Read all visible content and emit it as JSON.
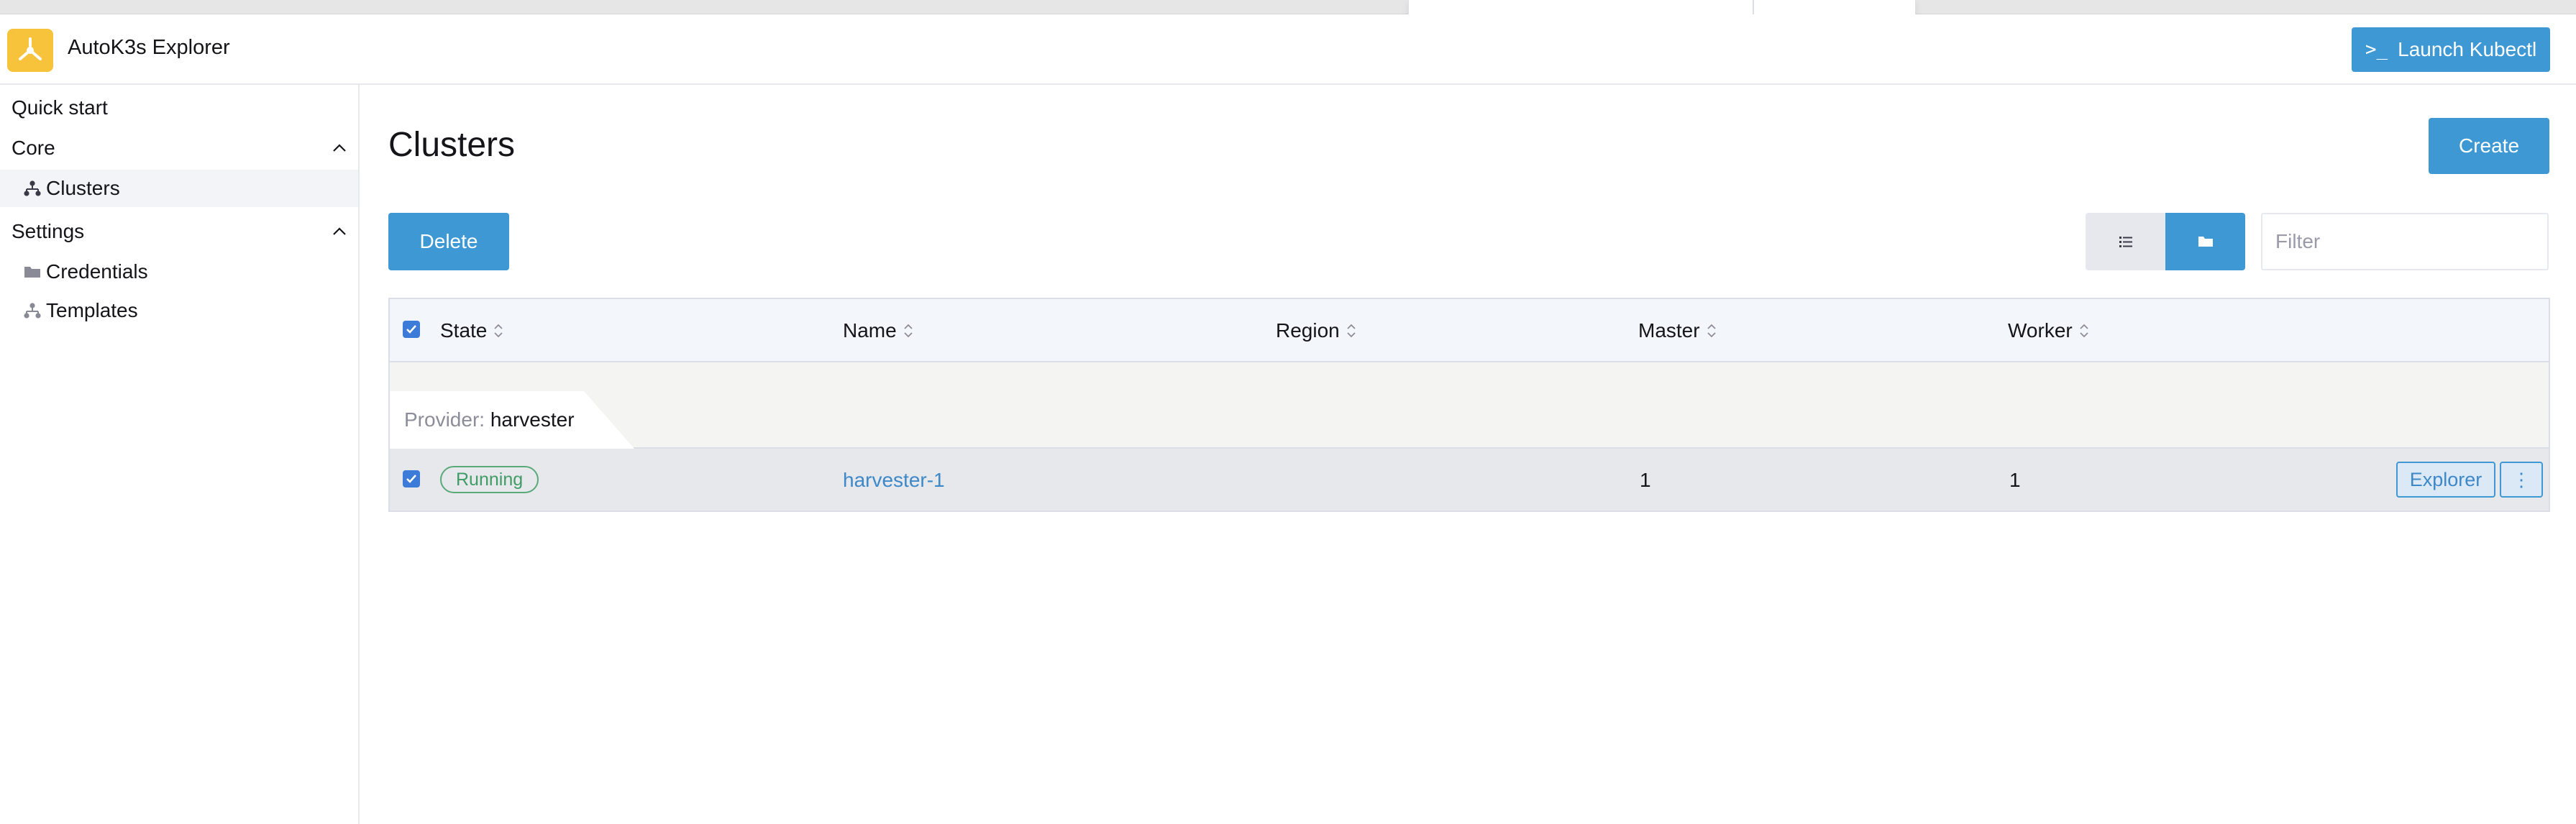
{
  "app": {
    "title": "AutoK3s Explorer",
    "logo_icon": "autok3s-logo-icon",
    "brand_color": "#f7c33a",
    "accent_color": "#3d98d3"
  },
  "header": {
    "launch_kubectl_label": "Launch Kubectl",
    "launch_kubectl_icon": "terminal-icon"
  },
  "sidebar": {
    "quick_start": "Quick start",
    "groups": [
      {
        "label": "Core",
        "items": [
          {
            "label": "Clusters",
            "icon": "cluster-icon",
            "active": true
          }
        ]
      },
      {
        "label": "Settings",
        "items": [
          {
            "label": "Credentials",
            "icon": "folder-icon"
          },
          {
            "label": "Templates",
            "icon": "cluster-icon"
          }
        ]
      }
    ]
  },
  "page": {
    "title": "Clusters",
    "create_label": "Create",
    "delete_label": "Delete",
    "filter_placeholder": "Filter",
    "view_modes": [
      {
        "icon": "list-icon",
        "selected": false
      },
      {
        "icon": "folder-icon",
        "selected": true
      }
    ]
  },
  "table": {
    "columns": [
      "State",
      "Name",
      "Region",
      "Master",
      "Worker"
    ],
    "group": {
      "key": "Provider:",
      "value": "harvester"
    },
    "rows": [
      {
        "state": "Running",
        "name": "harvester-1",
        "region": "",
        "master": "1",
        "worker": "1",
        "action_label": "Explorer",
        "kebab": "⋮"
      }
    ]
  }
}
